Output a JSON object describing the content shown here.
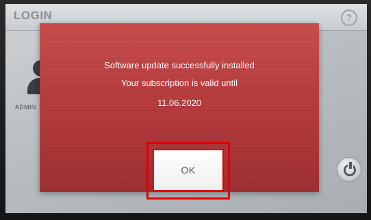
{
  "header": {
    "title": "LOGIN",
    "help_icon": "question-icon",
    "help_glyph": "?"
  },
  "users": [
    {
      "label": "ADMIN",
      "icon": "user-avatar-icon"
    }
  ],
  "power_icon": "power-icon",
  "dialog": {
    "message_line1": "Software update successfully installed",
    "message_line2": "Your subscription is valid until",
    "message_line3": "11.06.2020",
    "ok_label": "OK",
    "color": "#b53b3d",
    "highlight_color": "#e00000"
  }
}
